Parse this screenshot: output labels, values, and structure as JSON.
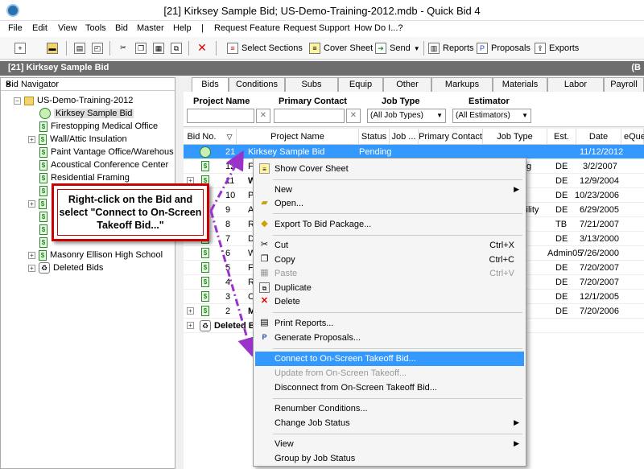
{
  "window": {
    "title": "[21] Kirksey Sample Bid; US-Demo-Training-2012.mdb - Quick Bid 4"
  },
  "menu": [
    "File",
    "Edit",
    "View",
    "Tools",
    "Bid",
    "Master",
    "Help",
    "|",
    "Request Feature",
    "Request Support",
    "How Do I...?"
  ],
  "toolbar": {
    "select_sections": "Select Sections",
    "cover_sheet": "Cover Sheet",
    "send": "Send",
    "reports": "Reports",
    "proposals": "Proposals",
    "exports": "Exports"
  },
  "bidbar": {
    "label": "[21] Kirksey Sample Bid",
    "right": "(B"
  },
  "navigator": {
    "title": "Bid Navigator",
    "close": "×",
    "items": [
      "US-Demo-Training-2012",
      "Kirksey Sample Bid",
      "Firestopping Medical Office",
      "Wall/Attic Insulation",
      "Paint Vantage Office/Warehous",
      "Acoustical Conference Center",
      "Residential Framing",
      "Masonry Ellison High School",
      "Deleted Bids"
    ]
  },
  "tabs": [
    "Bids",
    "Conditions",
    "Subs",
    "Equip",
    "Other",
    "Markups",
    "Materials",
    "Labor",
    "Payroll"
  ],
  "filters": {
    "project_name": "Project Name",
    "primary_contact": "Primary Contact",
    "job_type": "Job Type",
    "job_type_value": "(All Job Types)",
    "estimator": "Estimator",
    "estimator_value": "(All Estimators)",
    "clear": "✕"
  },
  "grid": {
    "headers": [
      "Bid No.",
      "Project Name",
      "Status",
      "Job ...",
      "Primary Contact",
      "Job Type",
      "Est.",
      "Date",
      "eQue"
    ],
    "rows": [
      {
        "no": "21",
        "name": "Kirksey Sample Bid",
        "status": "Pending",
        "type": "",
        "est": "",
        "date": "11/12/2012"
      },
      {
        "no": "12",
        "name": "Fi",
        "type": "g",
        "est": "DE",
        "date": "3/2/2007"
      },
      {
        "no": "11",
        "name": "W",
        "type": "",
        "est": "DE",
        "date": "12/9/2004"
      },
      {
        "no": "10",
        "name": "Pa",
        "type": "",
        "est": "DE",
        "date": "10/23/2006"
      },
      {
        "no": "9",
        "name": "Ac",
        "type": "cility",
        "est": "DE",
        "date": "6/29/2005"
      },
      {
        "no": "8",
        "name": "R",
        "type": "",
        "est": "TB",
        "date": "7/21/2007"
      },
      {
        "no": "7",
        "name": "D",
        "type": "",
        "est": "DE",
        "date": "3/13/2000"
      },
      {
        "no": "6",
        "name": "W",
        "type": "",
        "est": "Admin05",
        "date": "7/26/2000"
      },
      {
        "no": "5",
        "name": "Fi",
        "type": "",
        "est": "DE",
        "date": "7/20/2007"
      },
      {
        "no": "4",
        "name": "R",
        "type": "",
        "est": "DE",
        "date": "7/20/2007"
      },
      {
        "no": "3",
        "name": "C",
        "type": "",
        "est": "DE",
        "date": "12/1/2005"
      },
      {
        "no": "2",
        "name": "M",
        "type": "",
        "est": "DE",
        "date": "7/20/2006"
      },
      {
        "no": "",
        "name": "Deleted B",
        "type": "",
        "est": "",
        "date": ""
      }
    ]
  },
  "callout": "Right-click on the Bid and select \"Connect to On-Screen Takeoff Bid...\"",
  "context_menu": {
    "show_cover_sheet": "Show Cover Sheet",
    "new": "New",
    "open": "Open...",
    "export": "Export To Bid Package...",
    "cut": "Cut",
    "cut_sc": "Ctrl+X",
    "copy": "Copy",
    "copy_sc": "Ctrl+C",
    "paste": "Paste",
    "paste_sc": "Ctrl+V",
    "duplicate": "Duplicate",
    "delete": "Delete",
    "print_reports": "Print Reports...",
    "generate_proposals": "Generate Proposals...",
    "connect": "Connect to On-Screen Takeoff Bid...",
    "update": "Update from On-Screen Takeoff...",
    "disconnect": "Disconnect from On-Screen Takeoff Bid...",
    "renumber": "Renumber Conditions...",
    "change_status": "Change Job Status",
    "view": "View",
    "group_by": "Group by Job Status"
  },
  "colors": {
    "accent": "#3399ff",
    "callout_border": "#cc0000",
    "arrow": "#9933cc"
  }
}
